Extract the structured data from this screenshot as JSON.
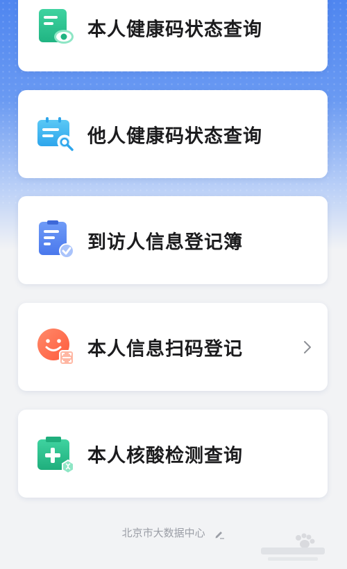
{
  "items": [
    {
      "label": "本人健康码状态查询",
      "icon": "health-code-view-icon"
    },
    {
      "label": "他人健康码状态查询",
      "icon": "health-code-search-icon"
    },
    {
      "label": "到访人信息登记簿",
      "icon": "visitor-register-icon"
    },
    {
      "label": "本人信息扫码登记",
      "icon": "face-scan-icon"
    },
    {
      "label": "本人核酸检测查询",
      "icon": "nucleic-acid-test-icon"
    }
  ],
  "footer": {
    "text": "北京市大数据中心",
    "icon": "edit-pen-icon"
  },
  "colors": {
    "accent_blue": "#4f86f0",
    "green": "#2fc08f",
    "orange": "#ff6a4a"
  }
}
